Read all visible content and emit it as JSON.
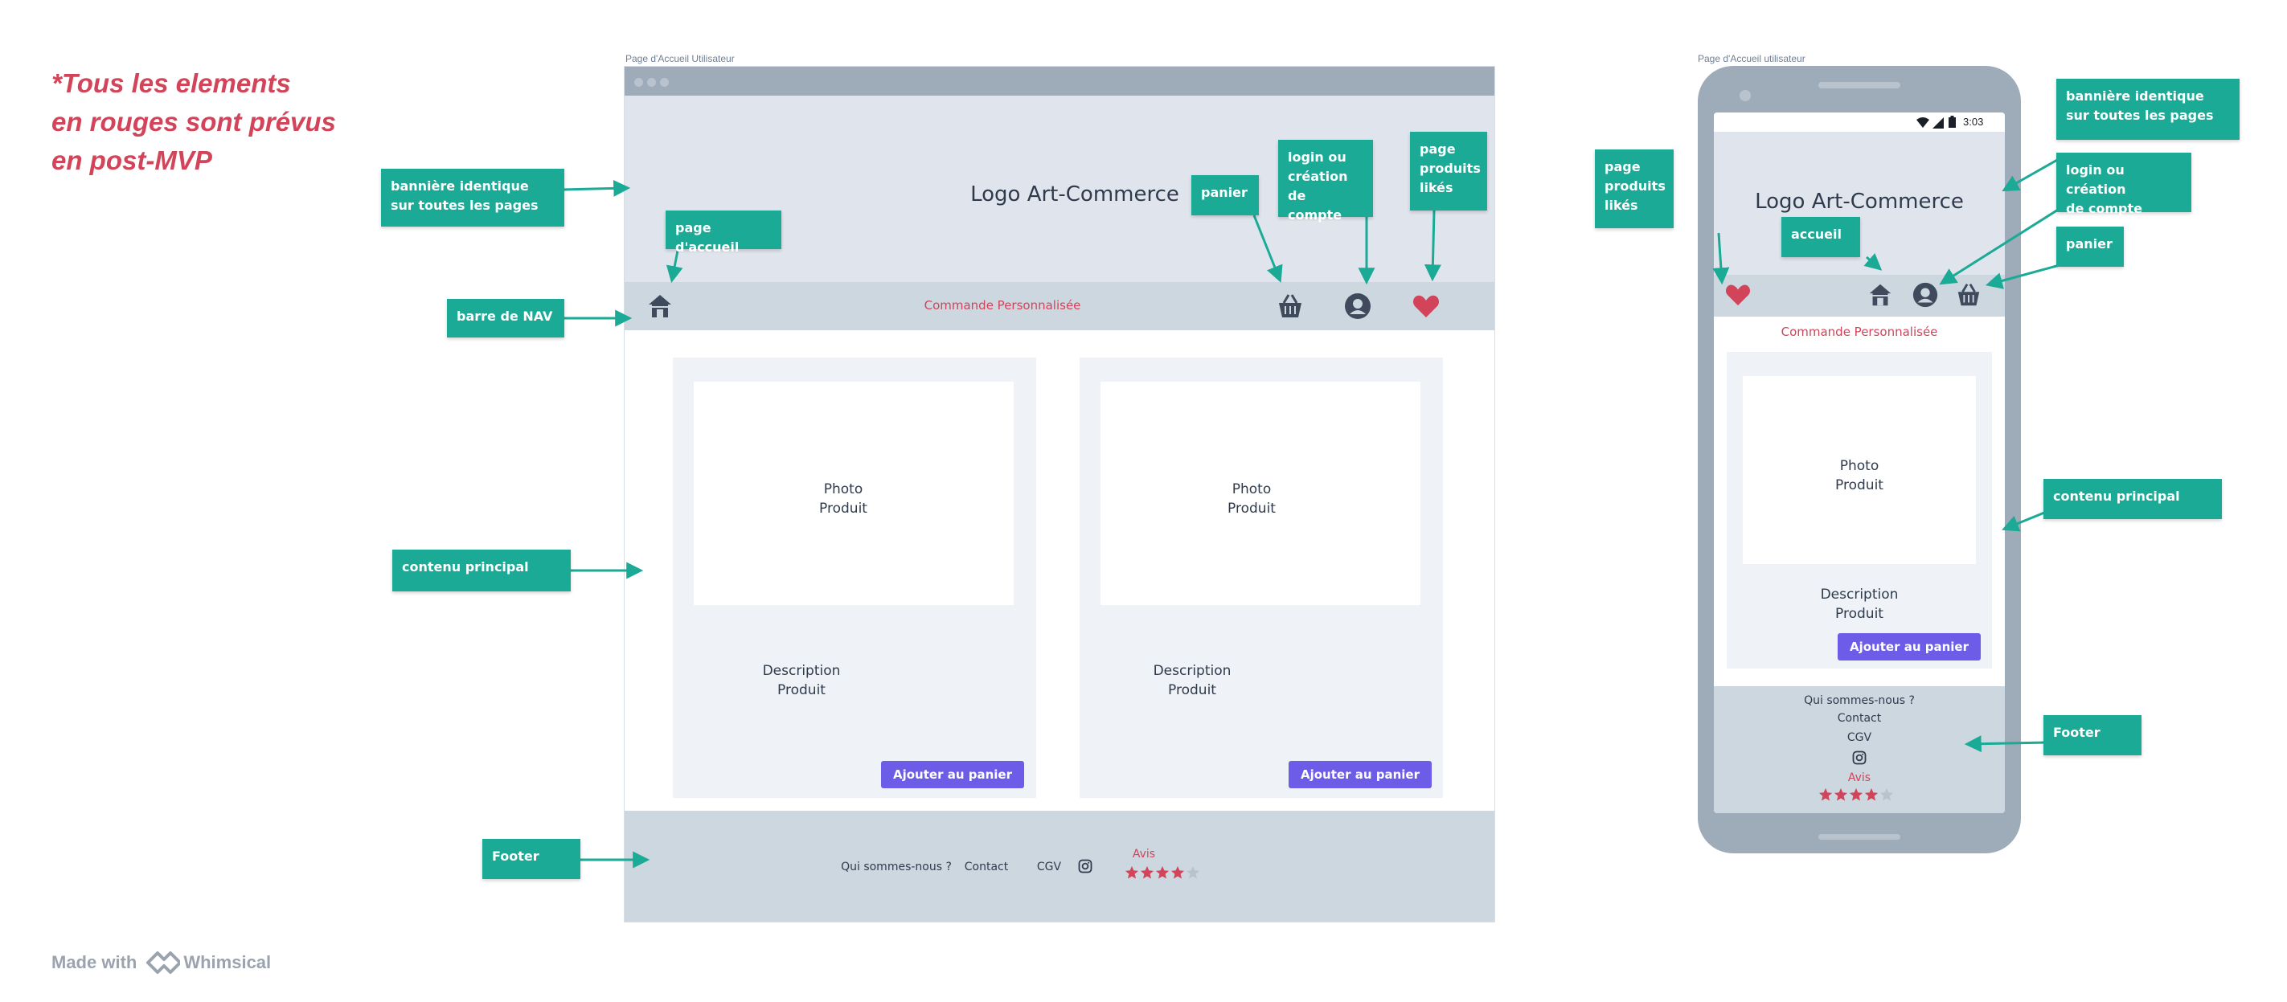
{
  "note_lines": [
    "*Tous les elements",
    "en rouges sont prévus",
    "en post-MVP"
  ],
  "branding": {
    "made_with": "Made with",
    "brand": "Whimsical"
  },
  "desktop": {
    "frame_label": "Page d'Accueil Utilisateur",
    "logo": "Logo Art-Commerce",
    "nav_link": "Commande Personnalisée",
    "cards": [
      {
        "photo_lines": [
          "Photo",
          "Produit"
        ],
        "desc_lines": [
          "Description",
          "Produit"
        ],
        "button": "Ajouter au panier"
      },
      {
        "photo_lines": [
          "Photo",
          "Produit"
        ],
        "desc_lines": [
          "Description",
          "Produit"
        ],
        "button": "Ajouter au panier"
      }
    ],
    "footer": {
      "about": "Qui sommes-nous ?",
      "contact": "Contact",
      "cgv": "CGV",
      "reviews_label": "Avis",
      "rating": 4,
      "max_rating": 5
    }
  },
  "mobile": {
    "frame_label": "Page d'Accueil utilisateur",
    "status_time": "3:03",
    "logo": "Logo Art-Commerce",
    "nav_link": "Commande Personnalisée",
    "card": {
      "photo_lines": [
        "Photo",
        "Produit"
      ],
      "desc_lines": [
        "Description",
        "Produit"
      ],
      "button": "Ajouter au panier"
    },
    "footer": {
      "about": "Qui sommes-nous ?",
      "contact": "Contact",
      "cgv": "CGV",
      "reviews_label": "Avis",
      "rating": 4,
      "max_rating": 5
    }
  },
  "callouts_desktop": {
    "banner": [
      "bannière identique",
      "sur toutes les pages"
    ],
    "home": [
      "page d'accueil"
    ],
    "nav": [
      "barre de NAV"
    ],
    "cart": [
      "panier"
    ],
    "login": [
      "login  ou",
      "création de",
      "compte"
    ],
    "liked": [
      "page",
      "produits",
      "likés"
    ],
    "main": [
      "contenu principal"
    ],
    "footer": [
      "Footer"
    ]
  },
  "callouts_mobile": {
    "liked": [
      "page",
      "produits",
      "likés"
    ],
    "home": [
      "accueil"
    ],
    "banner": [
      "bannière identique",
      "sur toutes les pages"
    ],
    "login": [
      "login  ou création",
      "de compte"
    ],
    "cart": [
      "panier"
    ],
    "main": [
      "contenu principal"
    ],
    "footer": [
      "Footer"
    ]
  },
  "colors": {
    "callout": "#1aaa96",
    "accent_red": "#d24459",
    "button": "#6c5ce7",
    "nav_bg": "#cdd7e0",
    "banner_bg": "#e0e5ed",
    "frame_grey": "#9eabb9"
  }
}
